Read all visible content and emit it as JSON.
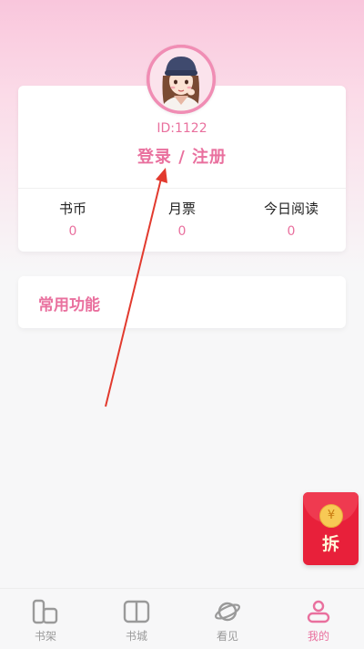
{
  "profile": {
    "user_id": "ID:1122",
    "login_label": "登录 / 注册",
    "stats": [
      {
        "label": "书币",
        "value": "0"
      },
      {
        "label": "月票",
        "value": "0"
      },
      {
        "label": "今日阅读",
        "value": "0"
      }
    ]
  },
  "common_functions": {
    "title": "常用功能"
  },
  "red_packet": {
    "coin_symbol": "¥",
    "label": "拆"
  },
  "tab_bar": {
    "items": [
      {
        "label": "书架",
        "icon": "bookshelf-icon",
        "active": false
      },
      {
        "label": "书城",
        "icon": "book-store-icon",
        "active": false
      },
      {
        "label": "看见",
        "icon": "planet-icon",
        "active": false
      },
      {
        "label": "我的",
        "icon": "profile-icon",
        "active": true
      }
    ]
  },
  "colors": {
    "accent": "#e9709e",
    "red_packet": "#e8203a",
    "inactive": "#9a9a9a"
  }
}
